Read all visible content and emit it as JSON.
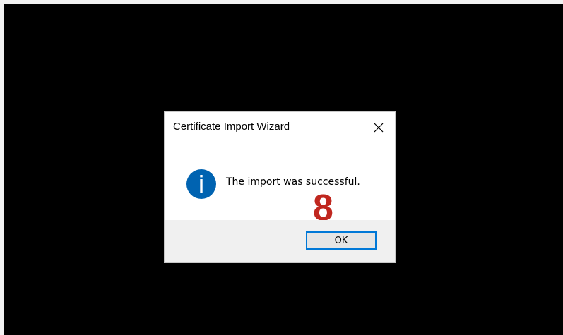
{
  "dialog": {
    "title": "Certificate Import Wizard",
    "message": "The import was successful.",
    "ok_label": "OK",
    "close_icon": "close-icon",
    "info_icon": "info-icon"
  },
  "annotation": {
    "step_number": "8",
    "color": "#c0271f"
  },
  "colors": {
    "accent": "#0078d7",
    "info_icon_fill": "#0063b1"
  }
}
